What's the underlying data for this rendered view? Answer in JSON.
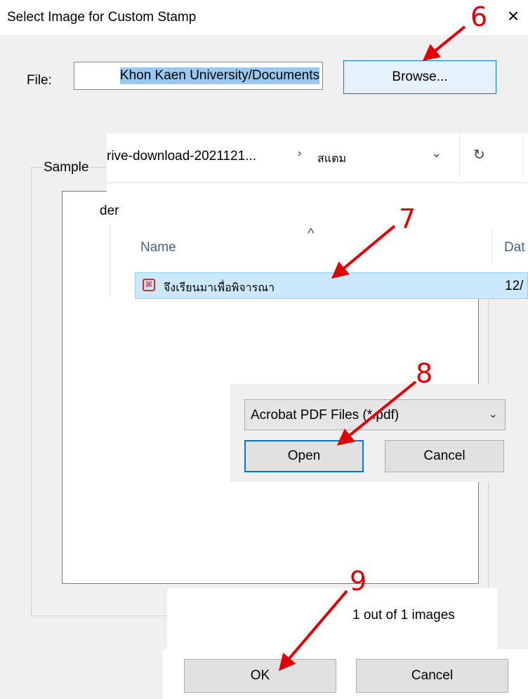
{
  "dialog": {
    "title": "Select Image for Custom Stamp",
    "close_icon": "×",
    "file_label": "File:",
    "file_value": "Khon Kaen University/Documents",
    "browse_label": "Browse...",
    "sample_label": "Sample",
    "image_count": "1 out of 1 images",
    "ok_label": "OK",
    "cancel_label": "Cancel"
  },
  "explorer": {
    "address_path": "rive-download-2021121...",
    "address_chevron": "›",
    "address_crumb": "สแตม",
    "dropdown_icon": "⌄",
    "refresh_icon": "↻",
    "folder_fragment": "der",
    "sort_arrow": "^",
    "column_name": "Name",
    "column_date": "Dat",
    "file_name": "จึงเรียนมาเพื่อพิจารณา",
    "file_date": "12/",
    "pdf_icon": "pdf-icon"
  },
  "open_dialog": {
    "filetype": "Acrobat PDF Files (*.pdf)",
    "filetype_chevron": "⌄",
    "open_label": "Open",
    "cancel_label": "Cancel"
  },
  "annotations": {
    "color": "#e10000",
    "steps": [
      "6",
      "7",
      "8",
      "9"
    ]
  }
}
